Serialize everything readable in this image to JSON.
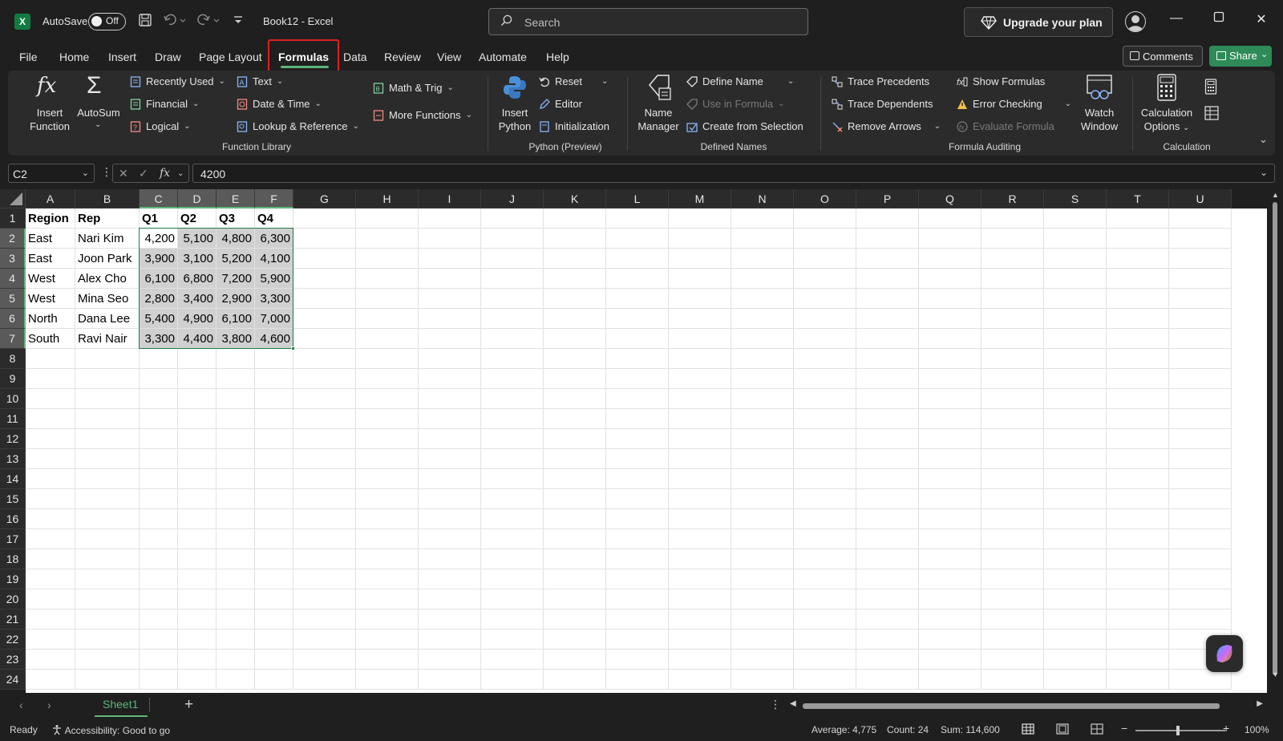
{
  "titlebar": {
    "autosave_label": "AutoSave",
    "autosave_state": "Off",
    "doc_title": "Book12  -  Excel",
    "search_placeholder": "Search",
    "upgrade_label": "Upgrade your plan"
  },
  "menu": {
    "tabs": [
      "File",
      "Home",
      "Insert",
      "Draw",
      "Page Layout",
      "Formulas",
      "Data",
      "Review",
      "View",
      "Automate",
      "Help"
    ],
    "active": "Formulas",
    "comments_label": "Comments",
    "share_label": "Share"
  },
  "ribbon": {
    "function_library": {
      "label": "Function Library",
      "insert_function": [
        "Insert",
        "Function"
      ],
      "autosum": "AutoSum",
      "recently_used": "Recently Used",
      "financial": "Financial",
      "logical": "Logical",
      "text": "Text",
      "date_time": "Date & Time",
      "lookup_reference": "Lookup & Reference",
      "math_trig": "Math & Trig",
      "more_functions": "More Functions"
    },
    "python": {
      "label": "Python (Preview)",
      "insert_python": [
        "Insert",
        "Python"
      ],
      "reset": "Reset",
      "editor": "Editor",
      "initialization": "Initialization"
    },
    "defined_names": {
      "label": "Defined Names",
      "name_manager": [
        "Name",
        "Manager"
      ],
      "define_name": "Define Name",
      "use_in_formula": "Use in Formula",
      "create_from_selection": "Create from Selection"
    },
    "formula_auditing": {
      "label": "Formula Auditing",
      "trace_precedents": "Trace Precedents",
      "trace_dependents": "Trace Dependents",
      "remove_arrows": "Remove Arrows",
      "show_formulas": "Show Formulas",
      "error_checking": "Error Checking",
      "evaluate_formula": "Evaluate Formula",
      "watch_window": [
        "Watch",
        "Window"
      ]
    },
    "calculation": {
      "label": "Calculation",
      "calculation_options": [
        "Calculation",
        "Options"
      ]
    }
  },
  "formula_bar": {
    "name_box": "C2",
    "value": "4200"
  },
  "grid": {
    "columns": [
      "A",
      "B",
      "C",
      "D",
      "E",
      "F",
      "G",
      "H",
      "I",
      "J",
      "K",
      "L",
      "M",
      "N",
      "O",
      "P",
      "Q",
      "R",
      "S",
      "T",
      "U"
    ],
    "rows": [
      "1",
      "2",
      "3",
      "4",
      "5",
      "6",
      "7",
      "8",
      "9",
      "10",
      "11",
      "12",
      "13",
      "14",
      "15",
      "16",
      "17",
      "18",
      "19",
      "20",
      "21",
      "22",
      "23",
      "24"
    ],
    "header": [
      "Region",
      "Rep",
      "Q1",
      "Q2",
      "Q3",
      "Q4"
    ],
    "data": [
      [
        "East",
        "Nari Kim",
        "4,200",
        "5,100",
        "4,800",
        "6,300"
      ],
      [
        "East",
        "Joon Park",
        "3,900",
        "3,100",
        "5,200",
        "4,100"
      ],
      [
        "West",
        "Alex Cho",
        "6,100",
        "6,800",
        "7,200",
        "5,900"
      ],
      [
        "West",
        "Mina Seo",
        "2,800",
        "3,400",
        "2,900",
        "3,300"
      ],
      [
        "North",
        "Dana Lee",
        "5,400",
        "4,900",
        "6,100",
        "7,000"
      ],
      [
        "South",
        "Ravi Nair",
        "3,300",
        "4,400",
        "3,800",
        "4,600"
      ]
    ]
  },
  "sheets": {
    "tabs": [
      "Sheet1"
    ],
    "active": "Sheet1"
  },
  "status": {
    "ready": "Ready",
    "accessibility": "Accessibility: Good to go",
    "average": "Average: 4,775",
    "count": "Count: 24",
    "sum": "Sum: 114,600",
    "zoom": "100%"
  },
  "colors": {
    "accent_green": "#5fb67a",
    "excel_green": "#107c41",
    "share_green": "#2e8b57",
    "highlight_red": "#e02020"
  }
}
